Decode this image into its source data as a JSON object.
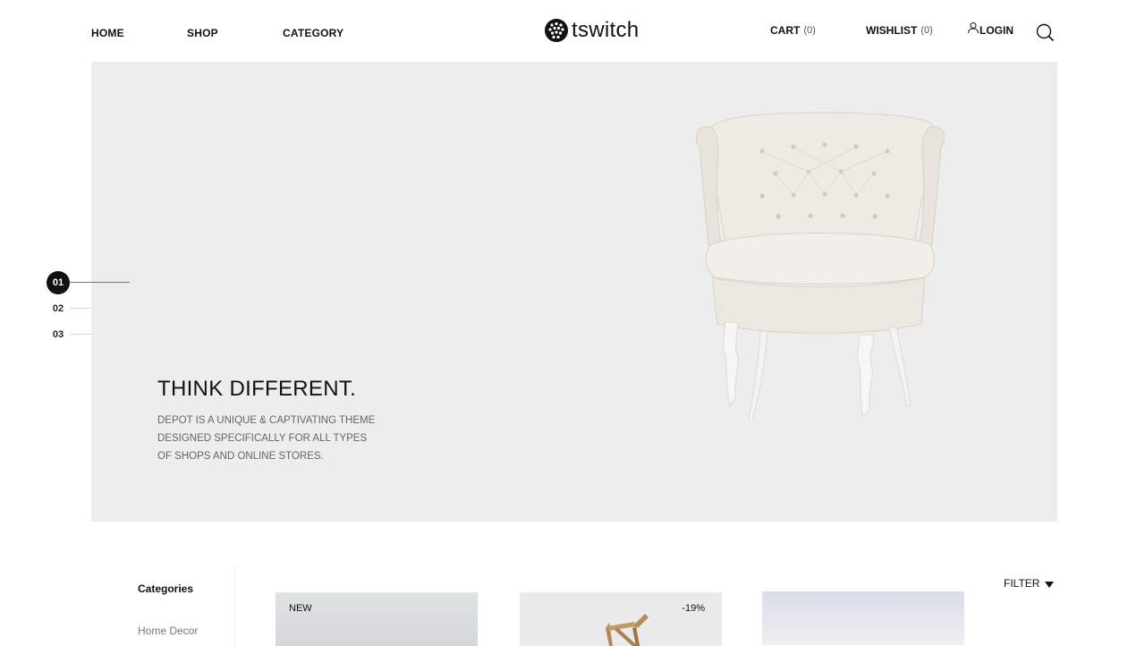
{
  "header": {
    "nav": {
      "home": "HOME",
      "shop": "SHOP",
      "category": "CATEGORY"
    },
    "logo_text": "tswitch",
    "cart_label": "CART",
    "cart_count": "(0)",
    "wishlist_label": "WISHLIST",
    "wishlist_count": "(0)",
    "login_label": "LOGIN",
    "icons": [
      "user-icon",
      "search-icon"
    ]
  },
  "hero": {
    "title": "THINK DIFFERENT.",
    "description": "DEPOT IS A UNIQUE & CAPTIVATING THEME DESIGNED SPECIFICALLY FOR ALL TYPES OF SHOPS AND ONLINE STORES.",
    "slides": [
      "01",
      "02",
      "03"
    ],
    "active_slide": "01",
    "background_color": "#ecedec"
  },
  "shop": {
    "sidebar_title": "Categories",
    "sidebar_items": [
      "Home Decor"
    ],
    "filter_label": "FILTER",
    "products": [
      {
        "badge": "NEW"
      },
      {
        "badge": "-19%"
      },
      {
        "badge": ""
      }
    ]
  }
}
